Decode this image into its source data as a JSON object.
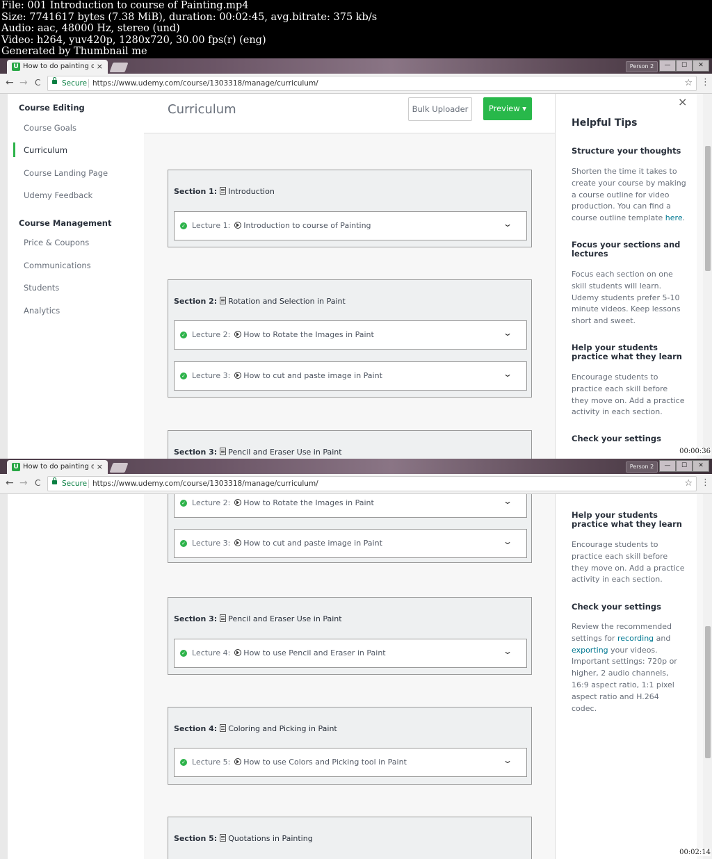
{
  "header": {
    "lines": [
      "File: 001 Introduction to course of Painting.mp4",
      "Size: 7741617 bytes (7.38 MiB), duration: 00:02:45, avg.bitrate: 375 kb/s",
      "Audio: aac, 48000 Hz, stereo (und)",
      "Video: h264, yuv420p, 1280x720, 30.00 fps(r) (eng)",
      "Generated by Thumbnail me"
    ]
  },
  "browser": {
    "tab_title": "How to do painting on C",
    "tab_close": "×",
    "favicon": "U",
    "profile": "Person 2",
    "win_min": "—",
    "win_max": "☐",
    "win_close": "✕",
    "back": "←",
    "forward": "→",
    "reload": "C",
    "secure_label": "Secure",
    "url": "https://www.udemy.com/course/1303318/manage/curriculum/",
    "star": "☆",
    "menu": "⋮"
  },
  "sidebar": {
    "course_editing": "Course Editing",
    "course_goals": "Course Goals",
    "curriculum": "Curriculum",
    "landing_page": "Course Landing Page",
    "udemy_feedback": "Udemy Feedback",
    "course_management": "Course Management",
    "price_coupons": "Price & Coupons",
    "communications": "Communications",
    "students": "Students",
    "analytics": "Analytics"
  },
  "main": {
    "title": "Curriculum",
    "bulk_uploader": "Bulk Uploader",
    "preview": "Preview ▾"
  },
  "sections": [
    {
      "label": "Section 1:",
      "title": "Introduction"
    },
    {
      "label": "Section 2:",
      "title": "Rotation and Selection in Paint"
    },
    {
      "label": "Section 3:",
      "title": "Pencil and Eraser Use in Paint"
    },
    {
      "label": "Section 4:",
      "title": "Coloring and Picking in Paint"
    },
    {
      "label": "Section 5:",
      "title": "Quotations in Painting"
    }
  ],
  "lectures": [
    {
      "label": "Lecture 1:",
      "title": "Introduction to course of Painting"
    },
    {
      "label": "Lecture 2:",
      "title": "How to Rotate the Images in Paint"
    },
    {
      "label": "Lecture 3:",
      "title": "How to cut and paste image in Paint"
    },
    {
      "label": "Lecture 4:",
      "title": "How to use Pencil and Eraser in Paint"
    },
    {
      "label": "Lecture 5:",
      "title": "How to use Colors and Picking tool in Paint"
    }
  ],
  "tips": {
    "close": "×",
    "title": "Helpful Tips",
    "structure_h": "Structure your thoughts",
    "structure_p": "Shorten the time it takes to create your course by making a course outline for video production. You can find a course outline template",
    "structure_link": "here",
    "structure_end": ".",
    "focus_h": "Focus your sections and lectures",
    "focus_p": "Focus each section on one skill students will learn. Udemy students prefer 5-10 minute videos. Keep lessons short and sweet.",
    "practice_h": "Help your students practice what they learn",
    "practice_p": "Encourage students to practice each skill before they move on. Add a practice activity in each section.",
    "settings_h": "Check your settings",
    "settings_p1": "Review the recommended settings for",
    "settings_link1": "recording",
    "settings_p2": "and",
    "settings_link2": "exporting",
    "settings_p3": "your videos. Important settings: 720p or higher, 2 audio channels, 16:9 aspect ratio, 1:1 pixel aspect ratio and H.264 codec."
  },
  "timestamps": {
    "frame1": "00:00:36",
    "frame2": "00:02:14"
  },
  "colors": {
    "accent_green": "#2db34a",
    "preview_green": "#28b84a",
    "link": "#007791"
  }
}
